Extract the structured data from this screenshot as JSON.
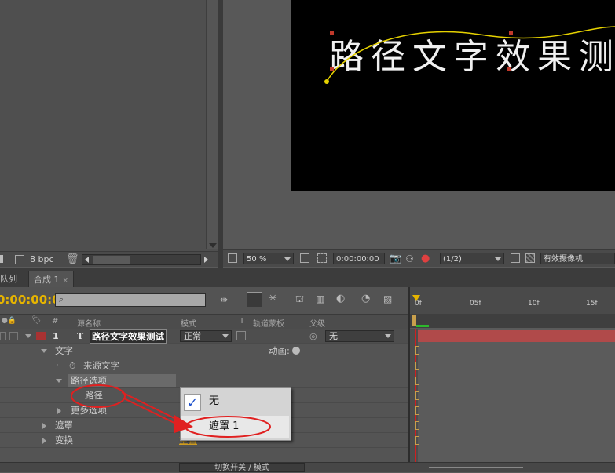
{
  "project_panel": {
    "bpc_label": "8 bpc"
  },
  "viewer": {
    "text": "路径文字效果测"
  },
  "comp_footer": {
    "zoom": "50 %",
    "timecode": "0:00:00:00",
    "resolution": "(1/2)",
    "camera": "有效摄像机"
  },
  "tabs": {
    "render_queue": "队列",
    "comp": "合成 1"
  },
  "timeline": {
    "current_time": "0:00:00:00",
    "ruler_ticks": [
      "0f",
      "05f",
      "10f",
      "15f"
    ],
    "columns": {
      "num": "#",
      "source_name": "源名称",
      "mode": "模式",
      "t": "T",
      "trkmat": "轨道蒙板",
      "parent": "父级"
    },
    "layer": {
      "number": "1",
      "type_glyph": "T",
      "name": "路径文字效果测试",
      "mode": "正常",
      "parent": "无"
    },
    "rows": {
      "text_group": "文字",
      "animate": "动画:",
      "source_text": "来源文字",
      "path_options": "路径选项",
      "path": "路径",
      "more_options": "更多选项",
      "masks": "遮罩",
      "transform": "变换",
      "reset": "重置"
    },
    "bottom_button": "切换开关 / 模式"
  },
  "popup": {
    "items": [
      "无",
      "遮罩 1"
    ],
    "checked_index": 0
  },
  "colors": {
    "label_red": "#a83232",
    "track_red": "#b04a4a",
    "annotation_red": "#e02020",
    "path_yellow": "#e6d200",
    "timecode_yellow": "#e6b400",
    "check_blue": "#1b4fcc"
  }
}
